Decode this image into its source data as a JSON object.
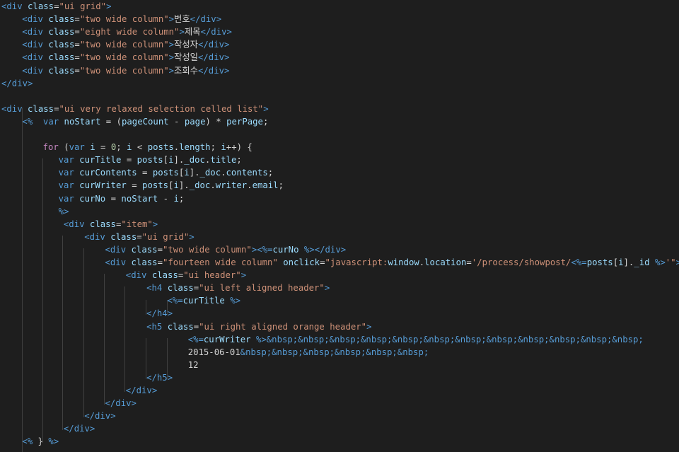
{
  "editor": {
    "lines": [
      {
        "indent": 0,
        "tokens": [
          [
            "t",
            "<div "
          ],
          [
            "a",
            "class"
          ],
          [
            "plain",
            "="
          ],
          [
            "s",
            "\"ui grid\""
          ],
          [
            "t",
            ">"
          ]
        ]
      },
      {
        "indent": 1,
        "tokens": [
          [
            "t",
            "<div "
          ],
          [
            "a",
            "class"
          ],
          [
            "plain",
            "="
          ],
          [
            "s",
            "\"two wide column\""
          ],
          [
            "t",
            ">"
          ],
          [
            "txt",
            "번호"
          ],
          [
            "t",
            "</div>"
          ]
        ]
      },
      {
        "indent": 1,
        "tokens": [
          [
            "t",
            "<div "
          ],
          [
            "a",
            "class"
          ],
          [
            "plain",
            "="
          ],
          [
            "s",
            "\"eight wide column\""
          ],
          [
            "t",
            ">"
          ],
          [
            "txt",
            "제목"
          ],
          [
            "t",
            "</div>"
          ]
        ]
      },
      {
        "indent": 1,
        "tokens": [
          [
            "t",
            "<div "
          ],
          [
            "a",
            "class"
          ],
          [
            "plain",
            "="
          ],
          [
            "s",
            "\"two wide column\""
          ],
          [
            "t",
            ">"
          ],
          [
            "txt",
            "작성자"
          ],
          [
            "t",
            "</div>"
          ]
        ]
      },
      {
        "indent": 1,
        "tokens": [
          [
            "t",
            "<div "
          ],
          [
            "a",
            "class"
          ],
          [
            "plain",
            "="
          ],
          [
            "s",
            "\"two wide column\""
          ],
          [
            "t",
            ">"
          ],
          [
            "txt",
            "작성일"
          ],
          [
            "t",
            "</div>"
          ]
        ]
      },
      {
        "indent": 1,
        "tokens": [
          [
            "t",
            "<div "
          ],
          [
            "a",
            "class"
          ],
          [
            "plain",
            "="
          ],
          [
            "s",
            "\"two wide column\""
          ],
          [
            "t",
            ">"
          ],
          [
            "txt",
            "조회수"
          ],
          [
            "t",
            "</div>"
          ]
        ]
      },
      {
        "indent": 0,
        "tokens": [
          [
            "t",
            "</div>"
          ]
        ]
      },
      {
        "indent": 0,
        "tokens": []
      },
      {
        "indent": 0,
        "tokens": [
          [
            "t",
            "<div "
          ],
          [
            "a",
            "class"
          ],
          [
            "plain",
            "="
          ],
          [
            "s",
            "\"ui very relaxed selection celled list\""
          ],
          [
            "t",
            ">"
          ]
        ]
      },
      {
        "indent": 1,
        "tokens": [
          [
            "d",
            "<%"
          ],
          [
            "plain",
            "  "
          ],
          [
            "k",
            "var"
          ],
          [
            "v",
            " noStart"
          ],
          [
            "plain",
            " = ("
          ],
          [
            "v",
            "pageCount"
          ],
          [
            "plain",
            " - "
          ],
          [
            "v",
            "page"
          ],
          [
            "plain",
            ") * "
          ],
          [
            "v",
            "perPage"
          ],
          [
            "plain",
            ";"
          ]
        ]
      },
      {
        "indent": 0,
        "tokens": []
      },
      {
        "indent": 2,
        "tokens": [
          [
            "kf",
            "for"
          ],
          [
            "plain",
            " ("
          ],
          [
            "k",
            "var"
          ],
          [
            "v",
            " i"
          ],
          [
            "plain",
            " = "
          ],
          [
            "n",
            "0"
          ],
          [
            "plain",
            "; "
          ],
          [
            "v",
            "i"
          ],
          [
            "plain",
            " < "
          ],
          [
            "v",
            "posts"
          ],
          [
            "plain",
            "."
          ],
          [
            "v",
            "length"
          ],
          [
            "plain",
            "; "
          ],
          [
            "v",
            "i"
          ],
          [
            "plain",
            "++) {"
          ]
        ]
      },
      {
        "indent": 2.75,
        "tokens": [
          [
            "k",
            "var"
          ],
          [
            "v",
            " curTitle"
          ],
          [
            "plain",
            " = "
          ],
          [
            "v",
            "posts"
          ],
          [
            "plain",
            "["
          ],
          [
            "v",
            "i"
          ],
          [
            "plain",
            "]."
          ],
          [
            "v",
            "_doc"
          ],
          [
            "plain",
            "."
          ],
          [
            "v",
            "title"
          ],
          [
            "plain",
            ";"
          ]
        ]
      },
      {
        "indent": 2.75,
        "tokens": [
          [
            "k",
            "var"
          ],
          [
            "v",
            " curContents"
          ],
          [
            "plain",
            " = "
          ],
          [
            "v",
            "posts"
          ],
          [
            "plain",
            "["
          ],
          [
            "v",
            "i"
          ],
          [
            "plain",
            "]."
          ],
          [
            "v",
            "_doc"
          ],
          [
            "plain",
            "."
          ],
          [
            "v",
            "contents"
          ],
          [
            "plain",
            ";"
          ]
        ]
      },
      {
        "indent": 2.75,
        "tokens": [
          [
            "k",
            "var"
          ],
          [
            "v",
            " curWriter"
          ],
          [
            "plain",
            " = "
          ],
          [
            "v",
            "posts"
          ],
          [
            "plain",
            "["
          ],
          [
            "v",
            "i"
          ],
          [
            "plain",
            "]."
          ],
          [
            "v",
            "_doc"
          ],
          [
            "plain",
            "."
          ],
          [
            "v",
            "writer"
          ],
          [
            "plain",
            "."
          ],
          [
            "v",
            "email"
          ],
          [
            "plain",
            ";"
          ]
        ]
      },
      {
        "indent": 2.75,
        "tokens": [
          [
            "k",
            "var"
          ],
          [
            "v",
            " curNo"
          ],
          [
            "plain",
            " = "
          ],
          [
            "v",
            "noStart"
          ],
          [
            "plain",
            " - "
          ],
          [
            "v",
            "i"
          ],
          [
            "plain",
            ";"
          ]
        ]
      },
      {
        "indent": 2.75,
        "tokens": [
          [
            "d",
            "%>"
          ]
        ]
      },
      {
        "indent": 3,
        "tokens": [
          [
            "t",
            "<div "
          ],
          [
            "a",
            "class"
          ],
          [
            "plain",
            "="
          ],
          [
            "s",
            "\"item\""
          ],
          [
            "t",
            ">"
          ]
        ]
      },
      {
        "indent": 4,
        "tokens": [
          [
            "t",
            "<div "
          ],
          [
            "a",
            "class"
          ],
          [
            "plain",
            "="
          ],
          [
            "s",
            "\"ui grid\""
          ],
          [
            "t",
            ">"
          ]
        ]
      },
      {
        "indent": 5,
        "tokens": [
          [
            "t",
            "<div "
          ],
          [
            "a",
            "class"
          ],
          [
            "plain",
            "="
          ],
          [
            "s",
            "\"two wide column\""
          ],
          [
            "t",
            ">"
          ],
          [
            "d",
            "<%="
          ],
          [
            "v",
            "curNo"
          ],
          [
            "d",
            " %>"
          ],
          [
            "t",
            "</div>"
          ]
        ]
      },
      {
        "indent": 5,
        "tokens": [
          [
            "t",
            "<div "
          ],
          [
            "a",
            "class"
          ],
          [
            "plain",
            "="
          ],
          [
            "s",
            "\"fourteen wide column\""
          ],
          [
            "a",
            " onclick"
          ],
          [
            "plain",
            "="
          ],
          [
            "s",
            "\"javascript:"
          ],
          [
            "v",
            "window"
          ],
          [
            "plain",
            "."
          ],
          [
            "v",
            "location"
          ],
          [
            "plain",
            "="
          ],
          [
            "s",
            "'/process/showpost/"
          ],
          [
            "d",
            "<%="
          ],
          [
            "v",
            "posts"
          ],
          [
            "plain",
            "["
          ],
          [
            "v",
            "i"
          ],
          [
            "plain",
            "]."
          ],
          [
            "v",
            "_id"
          ],
          [
            "d",
            " %>"
          ],
          [
            "s",
            "'\""
          ],
          [
            "t",
            ">"
          ]
        ]
      },
      {
        "indent": 6,
        "tokens": [
          [
            "t",
            "<div "
          ],
          [
            "a",
            "class"
          ],
          [
            "plain",
            "="
          ],
          [
            "s",
            "\"ui header\""
          ],
          [
            "t",
            ">"
          ]
        ]
      },
      {
        "indent": 7,
        "tokens": [
          [
            "t",
            "<h4 "
          ],
          [
            "a",
            "class"
          ],
          [
            "plain",
            "="
          ],
          [
            "s",
            "\"ui left aligned header\""
          ],
          [
            "t",
            ">"
          ]
        ]
      },
      {
        "indent": 8,
        "tokens": [
          [
            "d",
            "<%="
          ],
          [
            "v",
            "curTitle"
          ],
          [
            "d",
            " %>"
          ]
        ]
      },
      {
        "indent": 7,
        "tokens": [
          [
            "t",
            "</h4>"
          ]
        ]
      },
      {
        "indent": 7,
        "tokens": [
          [
            "t",
            "<h5 "
          ],
          [
            "a",
            "class"
          ],
          [
            "plain",
            "="
          ],
          [
            "s",
            "\"ui right aligned orange header\""
          ],
          [
            "t",
            ">"
          ]
        ]
      },
      {
        "indent": 9,
        "tokens": [
          [
            "d",
            "<%="
          ],
          [
            "v",
            "curWriter"
          ],
          [
            "d",
            " %>"
          ],
          [
            "ent",
            "&nbsp;&nbsp;&nbsp;&nbsp;&nbsp;&nbsp;&nbsp;&nbsp;&nbsp;&nbsp;&nbsp;&nbsp;"
          ]
        ]
      },
      {
        "indent": 9,
        "tokens": [
          [
            "txt",
            "2015-06-01"
          ],
          [
            "ent",
            "&nbsp;&nbsp;&nbsp;&nbsp;&nbsp;&nbsp;"
          ]
        ]
      },
      {
        "indent": 9,
        "tokens": [
          [
            "txt",
            "12"
          ]
        ]
      },
      {
        "indent": 7,
        "tokens": [
          [
            "t",
            "</h5>"
          ]
        ]
      },
      {
        "indent": 6,
        "tokens": [
          [
            "t",
            "</div>"
          ]
        ]
      },
      {
        "indent": 5,
        "tokens": [
          [
            "t",
            "</div>"
          ]
        ]
      },
      {
        "indent": 4,
        "tokens": [
          [
            "t",
            "</div>"
          ]
        ]
      },
      {
        "indent": 3,
        "tokens": [
          [
            "t",
            "</div>"
          ]
        ]
      },
      {
        "indent": 1,
        "tokens": [
          [
            "d",
            "<%"
          ],
          [
            "plain",
            " } "
          ],
          [
            "d",
            "%>"
          ]
        ]
      }
    ]
  }
}
